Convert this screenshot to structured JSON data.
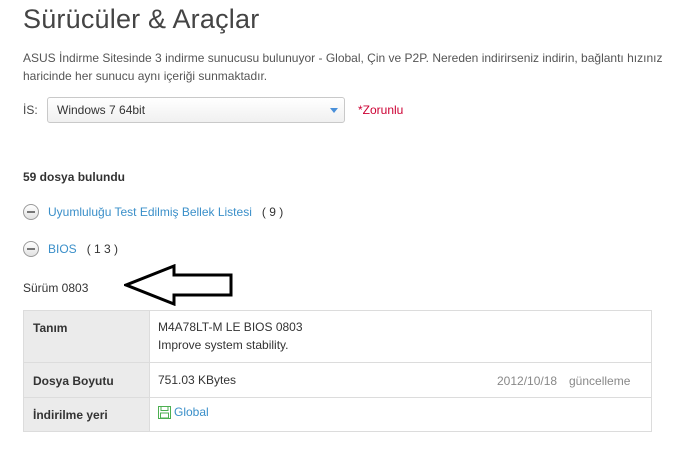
{
  "page": {
    "title": "Sürücüler & Araçlar",
    "description": "ASUS İndirme Sitesinde 3 indirme sunucusu bulunuyor - Global, Çin ve P2P. Nereden indirirseniz indirin, bağlantı hızınız haricinde her sunucu aynı içeriği sunmaktadır."
  },
  "os": {
    "label": "İS:",
    "selected": "Windows 7 64bit",
    "required": "*Zorunlu"
  },
  "results": {
    "count_text": "59 dosya bulundu",
    "categories": [
      {
        "name": "Uyumluluğu Test Edilmiş Bellek Listesi",
        "count": "( 9 )"
      },
      {
        "name": "BIOS",
        "count": "( 1 3 )"
      }
    ]
  },
  "item": {
    "version": "Sürüm 0803",
    "labels": {
      "description": "Tanım",
      "size": "Dosya Boyutu",
      "download": "İndirilme yeri"
    },
    "name": "M4A78LT-M LE BIOS 0803",
    "note": "Improve system stability.",
    "size": "751.03 KBytes",
    "date": "2012/10/18",
    "update_label": "güncelleme",
    "download_link": "Global"
  },
  "colors": {
    "link": "#3a8fc9",
    "required": "#cc0033",
    "caret": "#4a90d9"
  },
  "icons": [
    "minus-circle-icon",
    "chevron-down-icon",
    "floppy-disk-icon",
    "arrow-left-icon"
  ]
}
